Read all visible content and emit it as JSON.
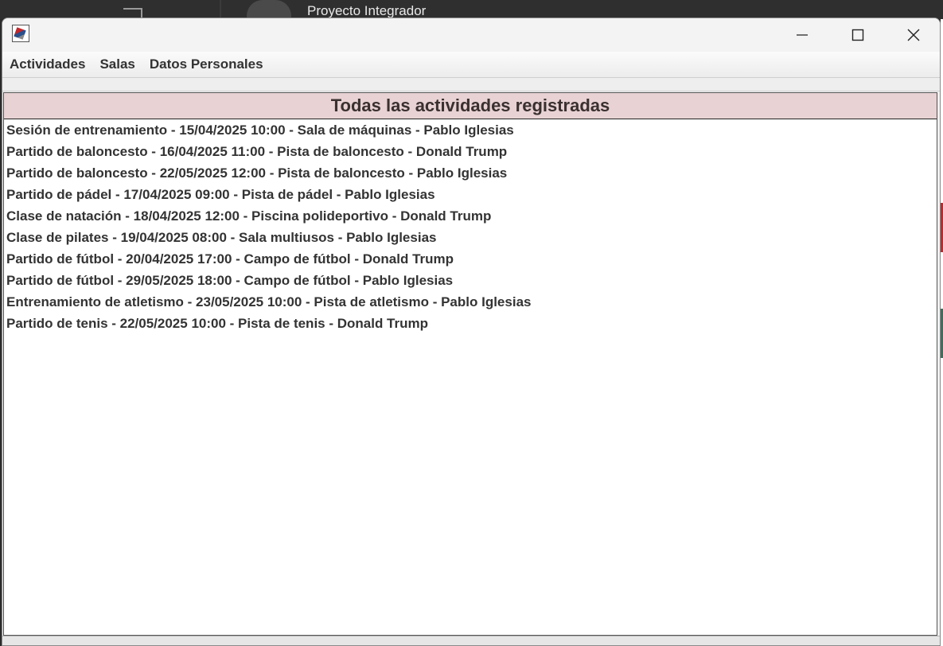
{
  "background": {
    "window_title": "Proyecto Integrador"
  },
  "window": {
    "icon": "java-app-icon",
    "controls": {
      "minimize": "minimize-icon",
      "maximize": "maximize-icon",
      "close": "close-icon"
    }
  },
  "menu": {
    "items": [
      {
        "label": "Actividades"
      },
      {
        "label": "Salas"
      },
      {
        "label": "Datos Personales"
      }
    ]
  },
  "panel": {
    "title": "Todas las actividades registradas",
    "activities": [
      "Sesión de entrenamiento - 15/04/2025 10:00 - Sala de máquinas - Pablo Iglesias",
      "Partido de baloncesto - 16/04/2025 11:00 - Pista de baloncesto - Donald Trump",
      "Partido de baloncesto - 22/05/2025 12:00 - Pista de baloncesto - Pablo Iglesias",
      "Partido de pádel - 17/04/2025 09:00 - Pista de pádel - Pablo Iglesias",
      "Clase de natación - 18/04/2025 12:00 - Piscina polideportivo - Donald Trump",
      "Clase de pilates - 19/04/2025 08:00 - Sala multiusos - Pablo Iglesias",
      "Partido de fútbol - 20/04/2025 17:00 - Campo de fútbol - Donald Trump",
      "Partido de fútbol - 29/05/2025 18:00 - Campo de fútbol - Pablo Iglesias",
      "Entrenamiento de atletismo - 23/05/2025 10:00 - Pista de atletismo - Pablo Iglesias",
      "Partido de tenis - 22/05/2025 10:00 - Pista de tenis - Donald Trump"
    ]
  },
  "colors": {
    "header_bg": "#e8d2d4",
    "text": "#333333"
  }
}
